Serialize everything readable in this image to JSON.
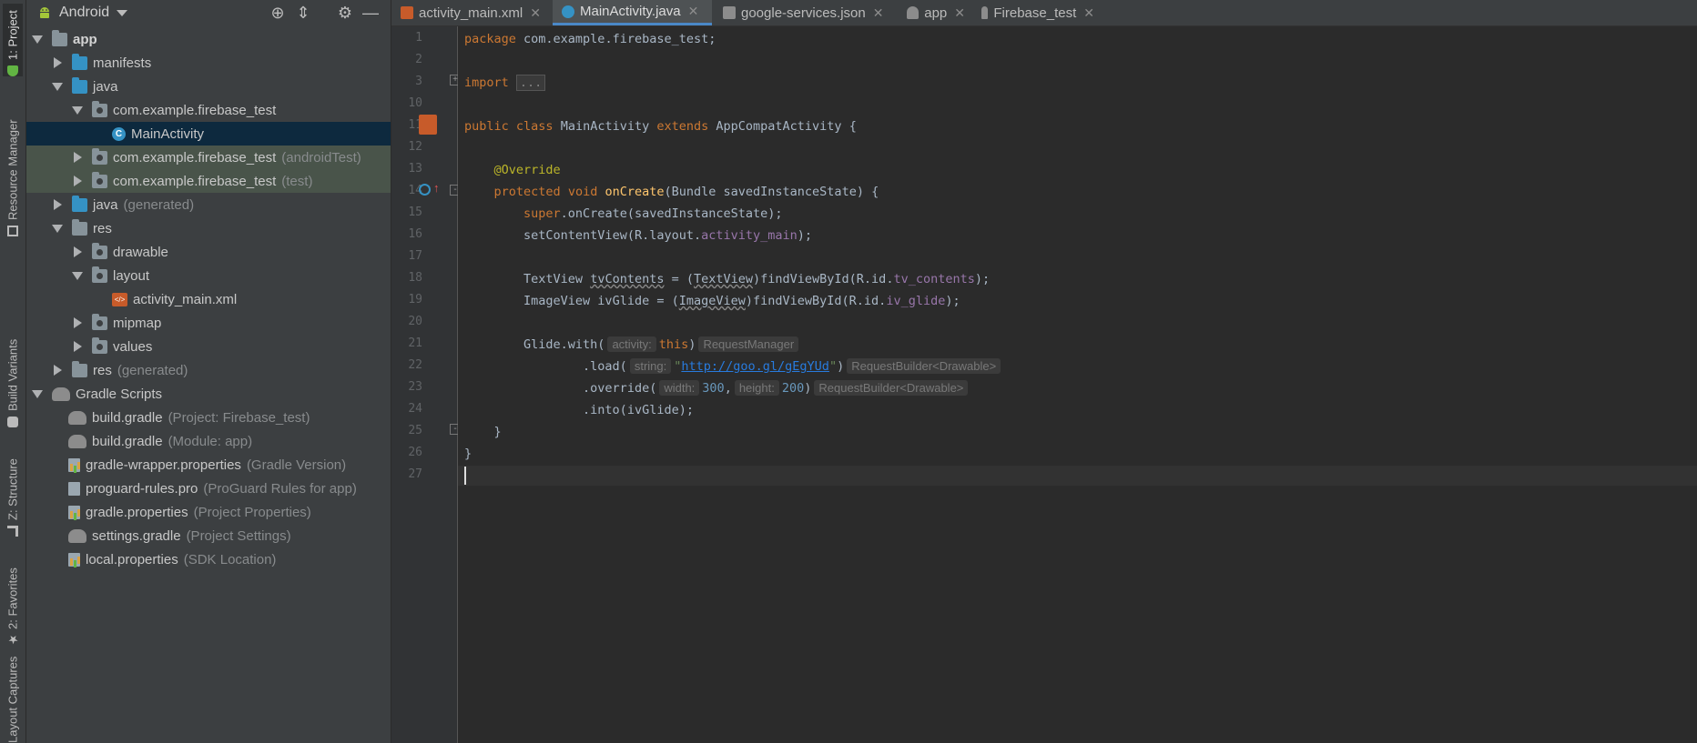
{
  "left_strip": {
    "tabs": [
      "1: Project",
      "Resource Manager",
      "Build Variants",
      "Z: Structure",
      "2: Favorites",
      "Layout Captures"
    ]
  },
  "project_panel": {
    "view_mode": "Android",
    "tree": [
      {
        "label": "app",
        "muted": ""
      },
      {
        "label": "manifests",
        "muted": ""
      },
      {
        "label": "java",
        "muted": ""
      },
      {
        "label": "com.example.firebase_test",
        "muted": ""
      },
      {
        "label": "MainActivity",
        "muted": ""
      },
      {
        "label": "com.example.firebase_test",
        "muted": "(androidTest)"
      },
      {
        "label": "com.example.firebase_test",
        "muted": "(test)"
      },
      {
        "label": "java",
        "muted": "(generated)"
      },
      {
        "label": "res",
        "muted": ""
      },
      {
        "label": "drawable",
        "muted": ""
      },
      {
        "label": "layout",
        "muted": ""
      },
      {
        "label": "activity_main.xml",
        "muted": ""
      },
      {
        "label": "mipmap",
        "muted": ""
      },
      {
        "label": "values",
        "muted": ""
      },
      {
        "label": "res",
        "muted": "(generated)"
      },
      {
        "label": "Gradle Scripts",
        "muted": ""
      },
      {
        "label": "build.gradle",
        "muted": "(Project: Firebase_test)"
      },
      {
        "label": "build.gradle",
        "muted": "(Module: app)"
      },
      {
        "label": "gradle-wrapper.properties",
        "muted": "(Gradle Version)"
      },
      {
        "label": "proguard-rules.pro",
        "muted": "(ProGuard Rules for app)"
      },
      {
        "label": "gradle.properties",
        "muted": "(Project Properties)"
      },
      {
        "label": "settings.gradle",
        "muted": "(Project Settings)"
      },
      {
        "label": "local.properties",
        "muted": "(SDK Location)"
      }
    ]
  },
  "editor_tabs": [
    {
      "label": "activity_main.xml",
      "close": "✕"
    },
    {
      "label": "MainActivity.java",
      "close": "✕"
    },
    {
      "label": "google-services.json",
      "close": "✕"
    },
    {
      "label": "app",
      "close": "✕"
    },
    {
      "label": "Firebase_test",
      "close": "✕"
    }
  ],
  "line_numbers": [
    "1",
    "2",
    "3",
    "10",
    "11",
    "12",
    "13",
    "14",
    "15",
    "16",
    "17",
    "18",
    "19",
    "20",
    "21",
    "22",
    "23",
    "24",
    "25",
    "26",
    "27"
  ],
  "code": {
    "l1": {
      "kw": "package",
      "rest": " com.example.firebase_test;"
    },
    "l3": {
      "kw": "import",
      "fold": "..."
    },
    "l11": {
      "kw1": "public",
      "kw2": "class",
      "name": " MainActivity ",
      "kw3": "extends",
      "rest": " AppCompatActivity {"
    },
    "l13": {
      "ann": "@Override"
    },
    "l14": {
      "kw1": "protected",
      "kw2": "void",
      "fn": "onCreate",
      "rest": "(Bundle savedInstanceState) {"
    },
    "l15": {
      "kw": "super",
      "rest": ".onCreate(savedInstanceState);"
    },
    "l16": {
      "a": "setContentView(R.layout.",
      "fld": "activity_main",
      "b": ");"
    },
    "l18": {
      "a": "TextView ",
      "var": "tvContents",
      "b": " = (",
      "cast": "TextView",
      "c": ")findViewById(R.id.",
      "fld": "tv_contents",
      "d": ");"
    },
    "l19": {
      "a": "ImageView ivGlide = (",
      "cast": "ImageView",
      "c": ")findViewById(R.id.",
      "fld": "iv_glide",
      "d": ");"
    },
    "l21": {
      "a": "Glide.with(",
      "hint": "activity:",
      "kw": "this",
      "b": ")",
      "type_hint": "RequestManager"
    },
    "l22": {
      "a": ".load(",
      "hint": "string:",
      "q1": "\"",
      "url": "http://goo.gl/gEgYUd",
      "q2": "\"",
      "b": ")",
      "type_hint": "RequestBuilder<Drawable>"
    },
    "l23": {
      "a": ".override(",
      "hint1": "width:",
      "n1": "300",
      "comma": ",",
      "hint2": "height:",
      "n2": "200",
      "b": ")",
      "type_hint": "RequestBuilder<Drawable>"
    },
    "l24": {
      "a": ".into(ivGlide);"
    },
    "l25": {
      "a": "}"
    },
    "l26": {
      "a": "}"
    }
  },
  "colors": {
    "keyword": "#cc7832",
    "annotation": "#bbb529",
    "method": "#ffc66d",
    "field": "#9876aa",
    "string": "#6a8759",
    "number": "#6897bb",
    "selection": "#0d293e"
  }
}
